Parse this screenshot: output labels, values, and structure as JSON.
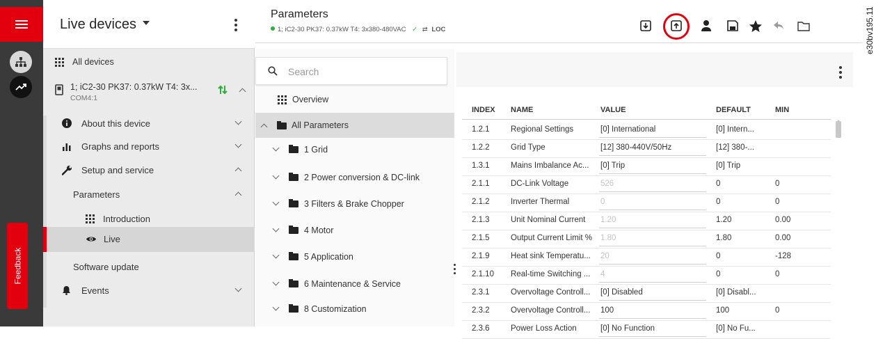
{
  "rail": {
    "menu_icon": "hamburger-icon",
    "feedback_label": "Feedback",
    "accent": "#e2000f"
  },
  "nav": {
    "title": "Live devices",
    "all_devices": "All devices",
    "device": {
      "name": "1; iC2-30 PK37: 0.37kW T4: 3x...",
      "port": "COM4:1"
    },
    "items": [
      {
        "label": "About this device",
        "icon": "info-icon",
        "expanded": false
      },
      {
        "label": "Graphs and reports",
        "icon": "chart-icon",
        "expanded": false
      },
      {
        "label": "Setup and service",
        "icon": "wrench-icon",
        "expanded": true
      },
      {
        "label": "Parameters",
        "expanded": true
      },
      {
        "label": "Introduction",
        "icon": "grid-icon"
      },
      {
        "label": "Live",
        "icon": "eye-icon",
        "selected": true
      },
      {
        "label": "Software update"
      },
      {
        "label": "Events",
        "icon": "bell-icon",
        "expanded": false
      }
    ]
  },
  "header": {
    "title": "Parameters",
    "device_line": "1; iC2-30 PK37: 0.37kW T4: 3x380-480VAC",
    "mode": "LOC",
    "toolbar_icons": [
      "download-icon",
      "upload-icon",
      "user-icon",
      "save-icon",
      "star-icon",
      "undo-icon",
      "folder-icon"
    ]
  },
  "tree": {
    "search_placeholder": "Search",
    "items": [
      {
        "label": "Overview"
      },
      {
        "label": "All Parameters",
        "selected": true
      },
      {
        "label": "1 Grid"
      },
      {
        "label": "2 Power conversion & DC-link"
      },
      {
        "label": "3 Filters & Brake Chopper"
      },
      {
        "label": "4 Motor"
      },
      {
        "label": "5 Application"
      },
      {
        "label": "6 Maintenance & Service"
      },
      {
        "label": "8 Customization"
      }
    ]
  },
  "table": {
    "columns": [
      "INDEX",
      "NAME",
      "VALUE",
      "DEFAULT",
      "MIN"
    ],
    "rows": [
      {
        "index": "1.2.1",
        "name": "Regional Settings",
        "value": "[0] International",
        "default": "[0] Intern...",
        "min": "",
        "readonly": false
      },
      {
        "index": "1.2.2",
        "name": "Grid Type",
        "value": "[12] 380-440V/50Hz",
        "default": "[12] 380-...",
        "min": "",
        "readonly": false
      },
      {
        "index": "1.3.1",
        "name": "Mains Imbalance Ac...",
        "value": "[0] Trip",
        "default": "[0] Trip",
        "min": "",
        "readonly": false
      },
      {
        "index": "2.1.1",
        "name": "DC-Link Voltage",
        "value": "526",
        "default": "0",
        "min": "0",
        "readonly": true
      },
      {
        "index": "2.1.2",
        "name": "Inverter Thermal",
        "value": "0",
        "default": "0",
        "min": "0",
        "readonly": true
      },
      {
        "index": "2.1.3",
        "name": "Unit Nominal Current",
        "value": "1.20",
        "default": "1.20",
        "min": "0.00",
        "readonly": true
      },
      {
        "index": "2.1.5",
        "name": "Output Current Limit %",
        "value": "1.80",
        "default": "1.80",
        "min": "0.00",
        "readonly": true
      },
      {
        "index": "2.1.9",
        "name": "Heat sink Temperatu...",
        "value": "20",
        "default": "0",
        "min": "-128",
        "readonly": true
      },
      {
        "index": "2.1.10",
        "name": "Real-time Switching ...",
        "value": "4",
        "default": "0",
        "min": "0",
        "readonly": true
      },
      {
        "index": "2.3.1",
        "name": "Overvoltage Controll...",
        "value": "[0] Disabled",
        "default": "[0] Disabl...",
        "min": "",
        "readonly": false
      },
      {
        "index": "2.3.2",
        "name": "Overvoltage Controll...",
        "value": "100",
        "default": "100",
        "min": "0",
        "readonly": false
      },
      {
        "index": "2.3.6",
        "name": "Power Loss Action",
        "value": "[0] No Function",
        "default": "[0] No Fu...",
        "min": "",
        "readonly": false
      }
    ]
  },
  "side_caption": "e30bv195.11"
}
